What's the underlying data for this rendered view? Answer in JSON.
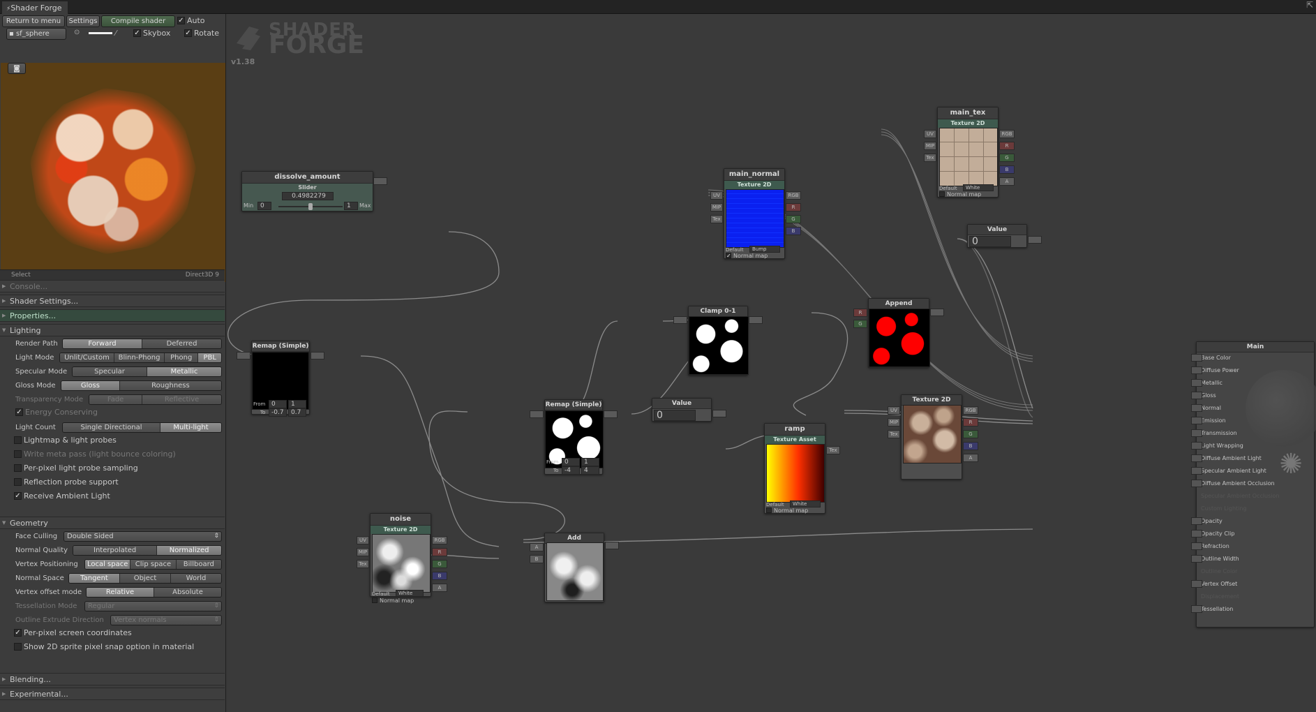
{
  "window": {
    "title": "Shader Forge",
    "close_glyph": "⇱"
  },
  "toolbar": {
    "return": "Return to menu",
    "settings": "Settings",
    "compile": "Compile shader",
    "auto": "Auto",
    "mesh": "sf_sphere",
    "skybox": "Skybox",
    "rotate": "Rotate"
  },
  "viewport": {
    "select": "Select",
    "api": "Direct3D 9",
    "bg_color": "#5a3e14"
  },
  "sections": {
    "console": "Console...",
    "shader_settings": "Shader Settings...",
    "properties": "Properties...",
    "lighting": "Lighting",
    "geometry": "Geometry",
    "blending": "Blending...",
    "experimental": "Experimental..."
  },
  "lighting": {
    "render_path": {
      "label": "Render Path",
      "options": [
        "Forward",
        "Deferred"
      ],
      "selected": "Forward"
    },
    "light_mode": {
      "label": "Light Mode",
      "options": [
        "Unlit/Custom",
        "Blinn-Phong",
        "Phong",
        "PBL"
      ],
      "selected": "PBL"
    },
    "specular_mode": {
      "label": "Specular Mode",
      "options": [
        "Specular",
        "Metallic"
      ],
      "selected": "Metallic"
    },
    "gloss_mode": {
      "label": "Gloss Mode",
      "options": [
        "Gloss",
        "Roughness"
      ],
      "selected": "Gloss"
    },
    "transparency_mode": {
      "label": "Transparency Mode",
      "options": [
        "Fade",
        "Reflective"
      ],
      "selected": "Fade"
    },
    "energy_conserving": "Energy Conserving",
    "light_count": {
      "label": "Light Count",
      "options": [
        "Single Directional",
        "Multi-light"
      ],
      "selected": "Multi-light"
    },
    "lightmap": "Lightmap & light probes",
    "meta_pass": "Write meta pass (light bounce coloring)",
    "per_pixel_probe": "Per-pixel light probe sampling",
    "reflection_probe": "Reflection probe support",
    "receive_ambient": "Receive Ambient Light"
  },
  "geometry": {
    "face_culling": {
      "label": "Face Culling",
      "value": "Double Sided"
    },
    "normal_quality": {
      "label": "Normal Quality",
      "options": [
        "Interpolated",
        "Normalized"
      ],
      "selected": "Normalized"
    },
    "vertex_positioning": {
      "label": "Vertex Positioning",
      "options": [
        "Local space",
        "Clip space",
        "Billboard"
      ],
      "selected": "Local space"
    },
    "normal_space": {
      "label": "Normal Space",
      "options": [
        "Tangent",
        "Object",
        "World"
      ],
      "selected": "Tangent"
    },
    "vertex_offset_mode": {
      "label": "Vertex offset mode",
      "options": [
        "Relative",
        "Absolute"
      ],
      "selected": "Relative"
    },
    "tessellation_mode": {
      "label": "Tessellation Mode",
      "value": "Regular"
    },
    "outline_extrude": {
      "label": "Outline Extrude Direction",
      "value": "Vertex normals"
    },
    "per_pixel_screen": "Per-pixel screen coordinates",
    "sprite_snap": "Show 2D sprite pixel snap option in material"
  },
  "canvas": {
    "logo_line1": "SHADER",
    "logo_line2": "FORGE",
    "version": "v1.38"
  },
  "nodes": {
    "dissolve": {
      "title": "dissolve_amount",
      "sub": "Slider",
      "value": "0.4982279",
      "min_label": "Min",
      "min": "0",
      "max": "1",
      "max_label": "Max"
    },
    "main_normal": {
      "title": "main_normal",
      "sub": "Texture 2D",
      "default_label": "Default",
      "default": "Bump",
      "normal_map": "Normal map"
    },
    "main_tex": {
      "title": "main_tex",
      "sub": "Texture 2D",
      "default_label": "Default",
      "default": "White",
      "normal_map": "Normal map"
    },
    "value1": {
      "title": "Value",
      "value": "0"
    },
    "value2": {
      "title": "Value",
      "value": "0"
    },
    "remap1": {
      "title": "Remap (Simple)",
      "from_label": "From",
      "from": [
        "0",
        "1"
      ],
      "to_label": "To",
      "to": [
        "-0.7",
        "0.7"
      ]
    },
    "remap2": {
      "title": "Remap (Simple)",
      "from_label": "From",
      "from": [
        "0",
        "1"
      ],
      "to_label": "To",
      "to": [
        "-4",
        "4"
      ]
    },
    "clamp": {
      "title": "Clamp 0-1"
    },
    "append": {
      "title": "Append"
    },
    "ramp": {
      "title": "ramp",
      "sub": "Texture Asset",
      "default_label": "Default",
      "default": "White",
      "normal_map": "Normal map"
    },
    "tex2d": {
      "title": "Texture 2D"
    },
    "noise": {
      "title": "noise",
      "sub": "Texture 2D",
      "default_label": "Default",
      "default": "White",
      "normal_map": "Normal map"
    },
    "add": {
      "title": "Add"
    },
    "main": {
      "title": "Main",
      "inputs": [
        "Base Color",
        "Diffuse Power",
        "Metallic",
        "Gloss",
        "Normal",
        "Emission",
        "Transmission",
        "Light Wrapping",
        "Diffuse Ambient Light",
        "Specular Ambient Light",
        "Diffuse Ambient Occlusion",
        "Specular Ambient Occlusion",
        "Custom Lighting",
        "Opacity",
        "Opacity Clip",
        "Refraction",
        "Outline Width",
        "Outline Color",
        "Vertex Offset",
        "Displacement",
        "Tessellation"
      ]
    }
  },
  "ports": {
    "uv": "UV",
    "mip": "MIP",
    "tex": "Tex",
    "rgb": "RGB",
    "r": "R",
    "g": "G",
    "b": "B",
    "a": "A"
  }
}
